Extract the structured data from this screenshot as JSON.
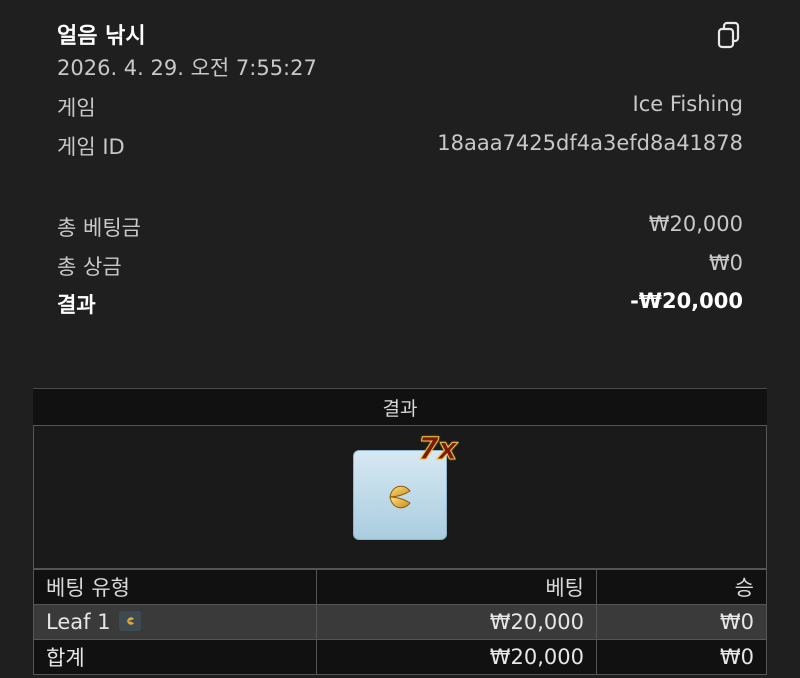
{
  "header": {
    "title": "얼음 낚시",
    "datetime": "2026. 4. 29. 오전 7:55:27"
  },
  "copy_icon": "copy-icon",
  "info": [
    {
      "label": "게임",
      "value": "Ice Fishing"
    },
    {
      "label": "게임 ID",
      "value": "18aaa7425df4a3efd8a41878"
    }
  ],
  "summary": [
    {
      "label": "총 베팅금",
      "value": "₩20,000"
    },
    {
      "label": "총 상금",
      "value": "₩0"
    },
    {
      "label": "결과",
      "value": "-₩20,000"
    }
  ],
  "result_section": {
    "heading": "결과",
    "multiplier": "7x",
    "tile_icon": "leaf-icon"
  },
  "bets_table": {
    "headers": [
      "베팅 유형",
      "베팅",
      "승"
    ],
    "rows": [
      {
        "type": "Leaf 1",
        "bet": "₩20,000",
        "win": "₩0"
      }
    ],
    "total": {
      "label": "합계",
      "bet": "₩20,000",
      "win": "₩0"
    }
  }
}
